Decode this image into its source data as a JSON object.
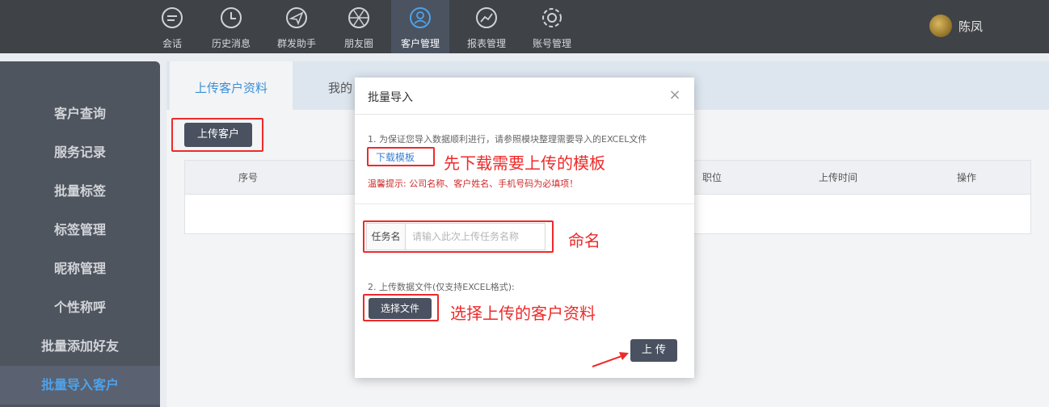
{
  "nav": {
    "items": [
      {
        "label": "会话",
        "icon": "chat-icon"
      },
      {
        "label": "历史消息",
        "icon": "clock-icon"
      },
      {
        "label": "群发助手",
        "icon": "paper-plane-icon"
      },
      {
        "label": "朋友圈",
        "icon": "aperture-icon"
      },
      {
        "label": "客户管理",
        "icon": "customer-icon"
      },
      {
        "label": "报表管理",
        "icon": "chart-icon"
      },
      {
        "label": "账号管理",
        "icon": "gear-icon"
      }
    ],
    "active_index": 4,
    "user_name": "陈凤"
  },
  "sidebar": {
    "items": [
      {
        "label": "客户查询"
      },
      {
        "label": "服务记录"
      },
      {
        "label": "批量标签"
      },
      {
        "label": "标签管理"
      },
      {
        "label": "昵称管理"
      },
      {
        "label": "个性称呼"
      },
      {
        "label": "批量添加好友"
      },
      {
        "label": "批量导入客户"
      }
    ],
    "active_index": 7
  },
  "main": {
    "tabs": [
      {
        "label": "上传客户资料"
      },
      {
        "label": "我的"
      }
    ],
    "upload_button": "上传客户",
    "table_headers": [
      "序号",
      "职位",
      "上传时间",
      "操作"
    ]
  },
  "modal": {
    "title": "批量导入",
    "step1_text": "1. 为保证您导入数据顺利进行，请参照模块整理需要导入的EXCEL文件",
    "download_link": "下载模板",
    "warning": "温馨提示: 公司名称、客户姓名、手机号码为必填项！",
    "task_label": "任务名",
    "task_placeholder": "请输入此次上传任务名称",
    "step2_text": "2. 上传数据文件(仅支持EXCEL格式):",
    "choose_file": "选择文件",
    "submit": "上 传"
  },
  "annotations": {
    "download_note": "先下载需要上传的模板",
    "name_note": "命名",
    "select_note": "选择上传的客户资料"
  },
  "colors": {
    "topbar": "#3f4246",
    "sidebar": "#4f555e",
    "accent": "#3b8fd6",
    "button": "#4a5160",
    "annotation_red": "#ee2a2a"
  }
}
